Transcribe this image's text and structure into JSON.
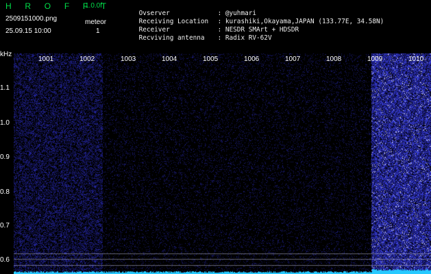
{
  "app": {
    "title": "H R O F F T",
    "version": "1.0.0f",
    "filename": "2509151000.png",
    "mode": "meteor",
    "datetime": "25.09.15 10:00",
    "count": "1"
  },
  "info": [
    {
      "key": "Ovserver",
      "value": ": @yuhmari"
    },
    {
      "key": "Receiving Location",
      "value": ": kurashiki,Okayama,JAPAN (133.77E, 34.58N)"
    },
    {
      "key": "Receiver",
      "value": ": NESDR SMArt + HDSDR"
    },
    {
      "key": "Recviving antenna",
      "value": ": Radix RV-62V"
    }
  ],
  "axis": {
    "unit": "kHz",
    "y_ticks": [
      "1.1",
      "1.0",
      "0.9",
      "0.8",
      "0.7",
      "0.6"
    ],
    "x_ticks": [
      "1001",
      "1002",
      "1003",
      "1004",
      "1005",
      "1006",
      "1007",
      "1008",
      "1009",
      "1010"
    ]
  },
  "colors": {
    "accent_green": "#00e04a",
    "signal_blue": "#2a3cff",
    "baseline_cyan": "#27c9ff"
  }
}
